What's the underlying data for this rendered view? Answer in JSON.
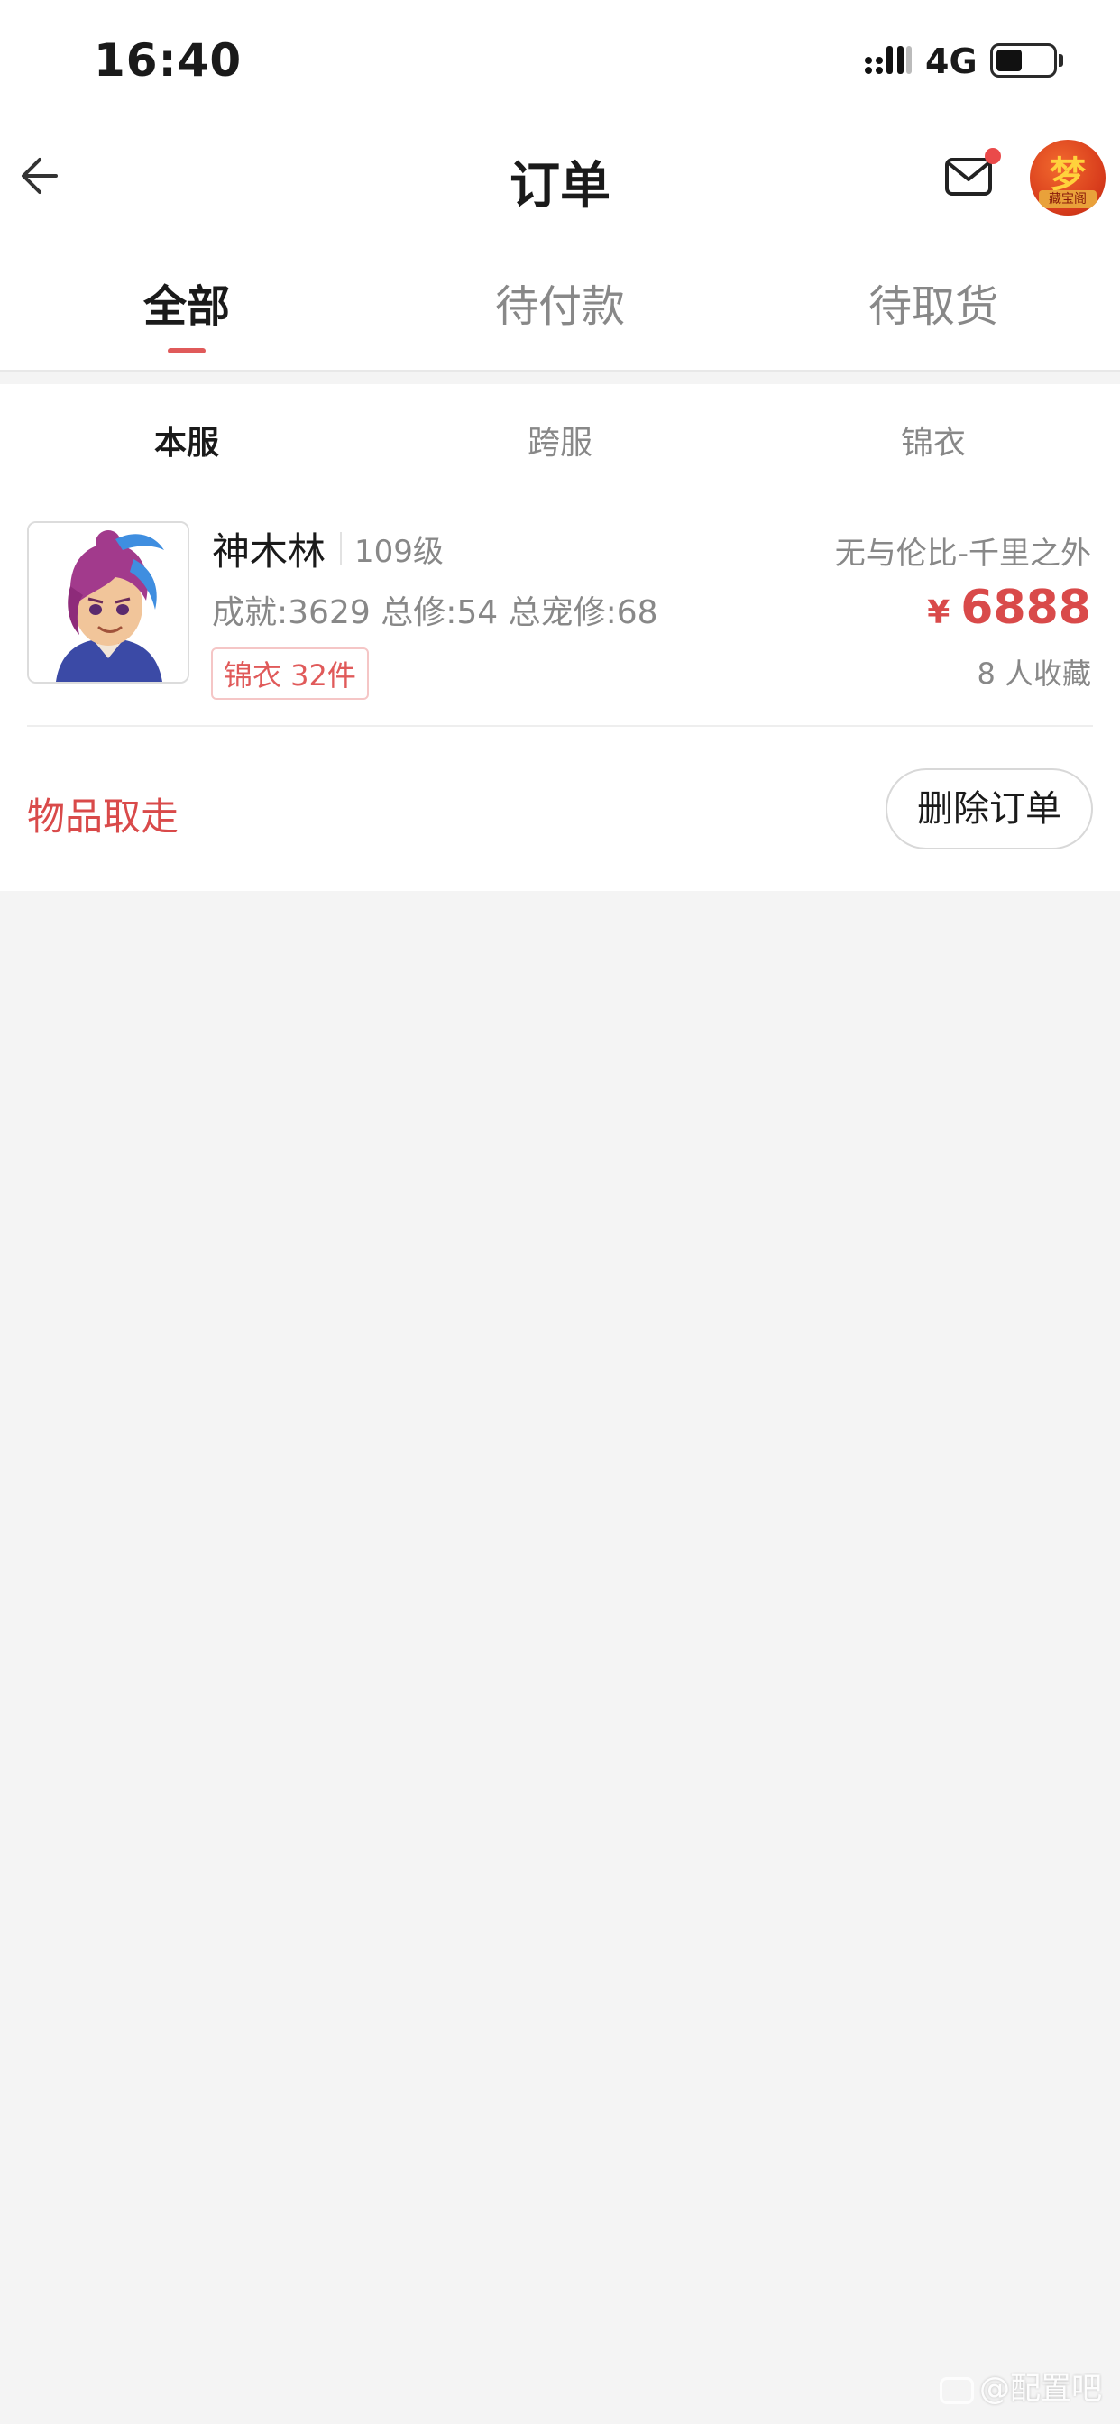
{
  "status_bar": {
    "time": "16:40",
    "network": "4G",
    "battery_level": 0.45
  },
  "nav": {
    "title": "订单",
    "back_icon": "back-arrow-icon",
    "mail_icon": "mail-icon",
    "mail_unread": true,
    "logo": {
      "char": "梦",
      "subtitle": "藏宝阁"
    }
  },
  "tabs": [
    {
      "label": "全部",
      "active": true
    },
    {
      "label": "待付款",
      "active": false
    },
    {
      "label": "待取货",
      "active": false
    }
  ],
  "subtabs": [
    {
      "label": "本服",
      "active": true
    },
    {
      "label": "跨服",
      "active": false
    },
    {
      "label": "锦衣",
      "active": false
    }
  ],
  "order": {
    "name": "神木林",
    "level": "109级",
    "server": "无与伦比-千里之外",
    "stats": "成就:3629 总修:54 总宠修:68",
    "price_currency": "¥",
    "price": "6888",
    "tag": "锦衣 32件",
    "favorites": "8 人收藏",
    "status": "物品取走",
    "delete_label": "删除订单"
  },
  "watermark": "@配置吧",
  "colors": {
    "accent": "#d94a4a",
    "tab_indicator": "#e05a5a",
    "background": "#f4f4f4",
    "muted_text": "#888888"
  }
}
